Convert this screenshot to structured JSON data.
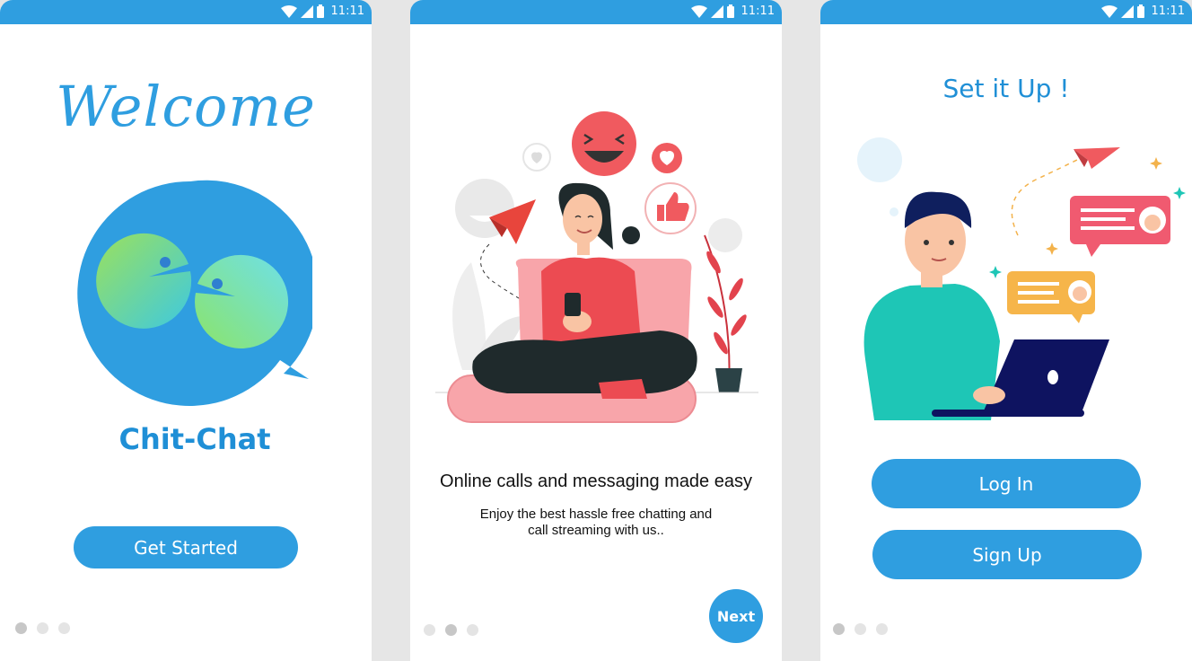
{
  "status_bar": {
    "time": "11:11"
  },
  "screen_welcome": {
    "heading": "Welcome",
    "app_name": "Chit-Chat",
    "button_label": "Get Started",
    "active_page": 1
  },
  "screen_features": {
    "headline": "Online calls and messaging made easy",
    "body_line1": "Enjoy the best hassle free chatting and",
    "body_line2": "call streaming with us..",
    "button_label": "Next",
    "active_page": 2
  },
  "screen_setup": {
    "heading": "Set it Up !",
    "login_label": "Log In",
    "signup_label": "Sign Up",
    "active_page": 1
  },
  "colors": {
    "primary": "#2f9ee0",
    "accent_red": "#f05a5f",
    "teal": "#1ec6b6"
  }
}
